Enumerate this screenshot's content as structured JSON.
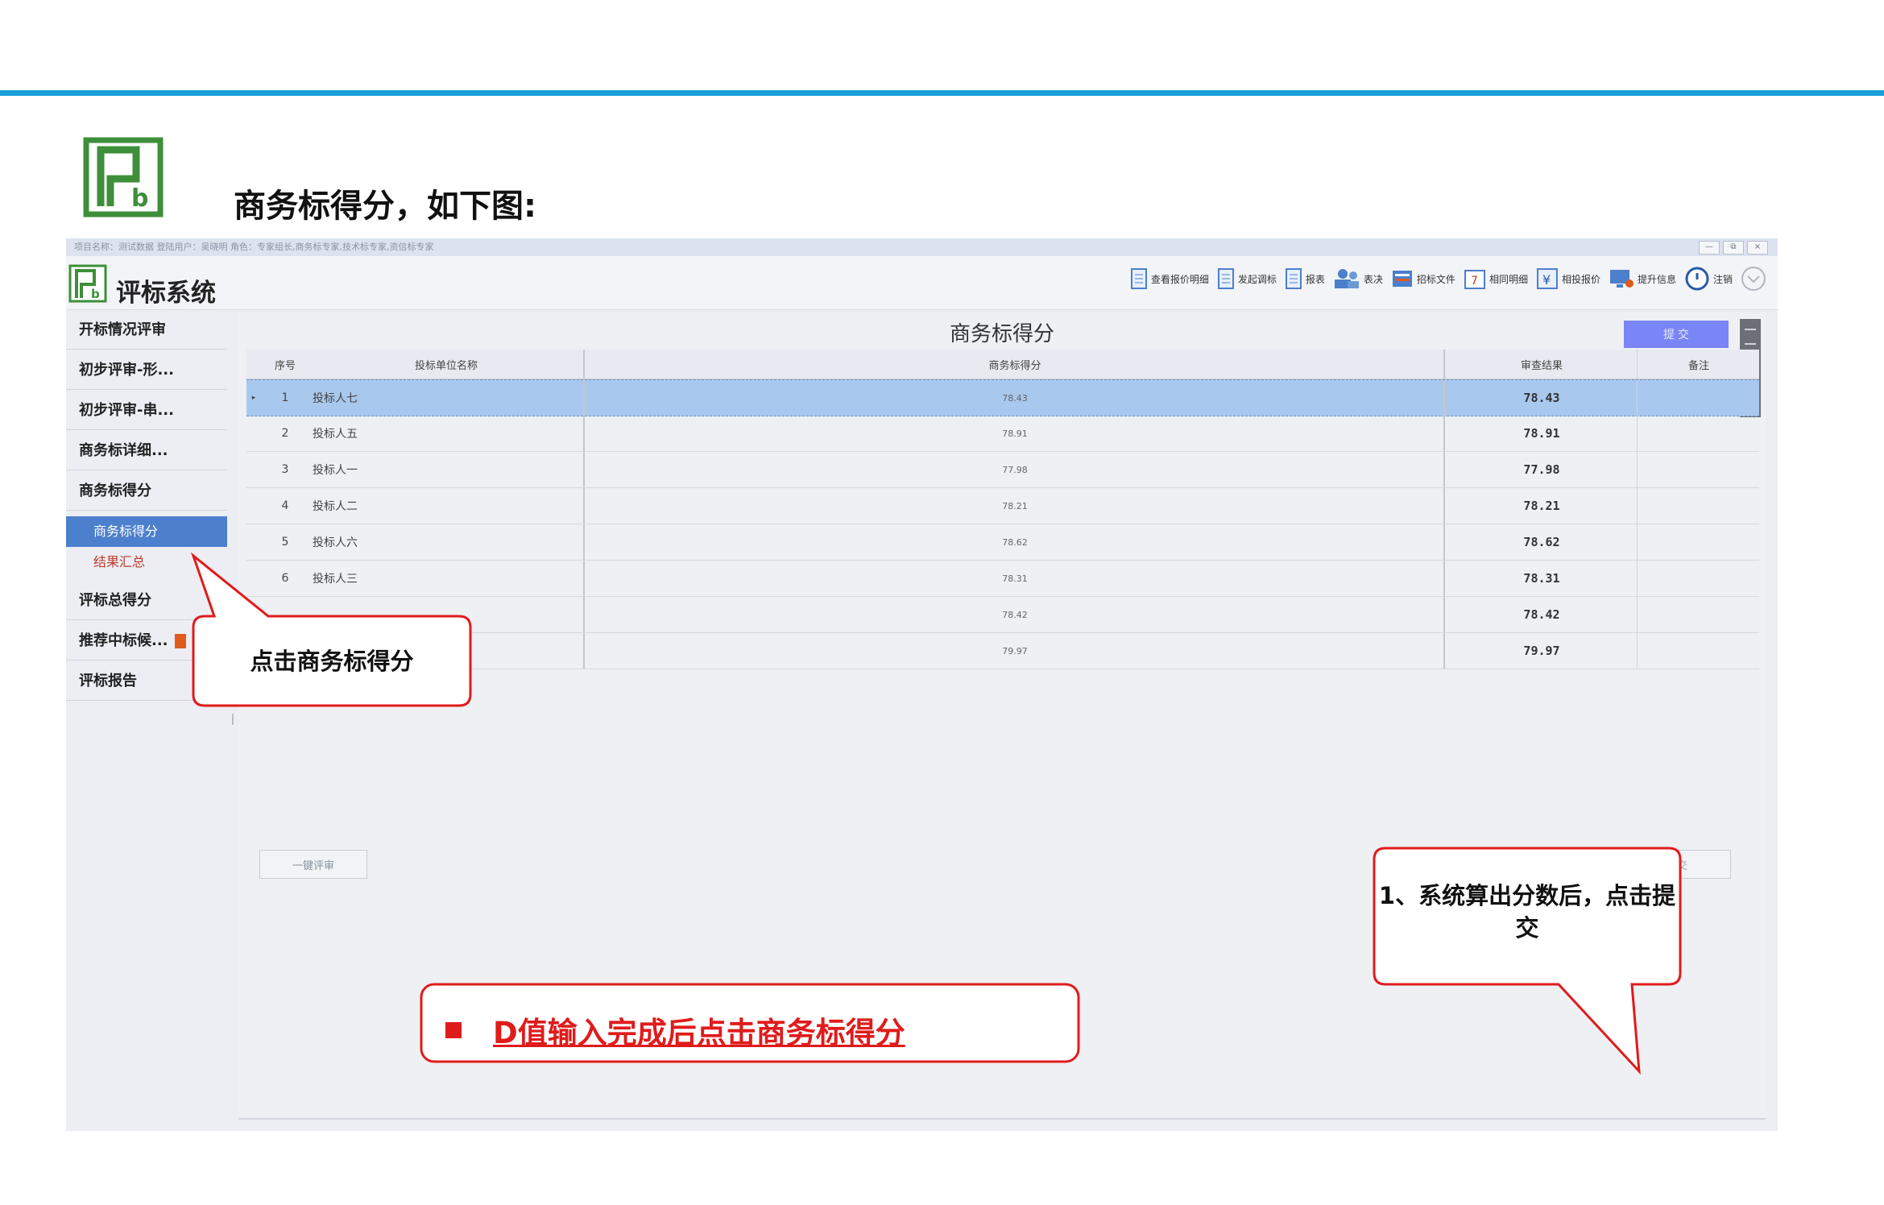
{
  "slide": {
    "title": "商务标得分，如下图:"
  },
  "colors": {
    "accent_line": "#1aa0db",
    "logo_green": "#3e8f3a",
    "annotation_red": "#e01b1b",
    "selected_row": "#a9c8ee",
    "active_nav": "#4c7fcc"
  },
  "window": {
    "titlebar_text": "项目名称：测试数据 登陆用户：吴晓明 角色：专家组长,商务标专家,技术标专家,资信标专家",
    "buttons": [
      "—",
      "⧉",
      "×"
    ]
  },
  "app": {
    "name": "评标系统"
  },
  "toolbar": {
    "items": [
      {
        "label": "查看报价明细",
        "icon": "document-icon"
      },
      {
        "label": "发起调标",
        "icon": "document-icon"
      },
      {
        "label": "报表",
        "icon": "document-icon"
      },
      {
        "label": "表决",
        "icon": "users-icon"
      },
      {
        "label": "招标文件",
        "icon": "file-icon"
      },
      {
        "label": "相同明细",
        "icon": "calendar-icon"
      },
      {
        "label": "相投报价",
        "icon": "yen-icon"
      },
      {
        "label": "提升信息",
        "icon": "monitor-icon"
      },
      {
        "label": "注销",
        "icon": "power-icon"
      }
    ]
  },
  "sidebar": {
    "items": [
      {
        "label": "开标情况评审"
      },
      {
        "label": "初步评审-形..."
      },
      {
        "label": "初步评审-串..."
      },
      {
        "label": "商务标详细..."
      },
      {
        "label": "商务标得分"
      }
    ],
    "sub_items": [
      {
        "label": "商务标得分"
      },
      {
        "label": "结果汇总"
      }
    ],
    "items_after": [
      {
        "label": "评标总得分"
      },
      {
        "label": "推荐中标候..."
      },
      {
        "label": "评标报告"
      }
    ]
  },
  "panel": {
    "title": "商务标得分",
    "submit_top_label": "提 交"
  },
  "grid": {
    "columns": [
      "序号",
      "投标单位名称",
      "商务标得分",
      "审查结果",
      "备注"
    ],
    "rows": [
      {
        "no": "1",
        "name": "投标人七",
        "score": "78.43",
        "result": "78.43",
        "note": ""
      },
      {
        "no": "2",
        "name": "投标人五",
        "score": "78.91",
        "result": "78.91",
        "note": ""
      },
      {
        "no": "3",
        "name": "投标人一",
        "score": "77.98",
        "result": "77.98",
        "note": ""
      },
      {
        "no": "4",
        "name": "投标人二",
        "score": "78.21",
        "result": "78.21",
        "note": ""
      },
      {
        "no": "5",
        "name": "投标人六",
        "score": "78.62",
        "result": "78.62",
        "note": ""
      },
      {
        "no": "6",
        "name": "投标人三",
        "score": "78.31",
        "result": "78.31",
        "note": ""
      },
      {
        "no": "",
        "name": "",
        "score": "78.42",
        "result": "78.42",
        "note": ""
      },
      {
        "no": "",
        "name": "",
        "score": "79.97",
        "result": "79.97",
        "note": ""
      }
    ]
  },
  "bottom": {
    "one_key_label": "一键评审",
    "submit_label": "提交"
  },
  "annotations": {
    "callout_click": "点击商务标得分",
    "callout_submit": "1、系统算出分数后，点击提交",
    "note": "D值输入完成后点击商务标得分"
  }
}
